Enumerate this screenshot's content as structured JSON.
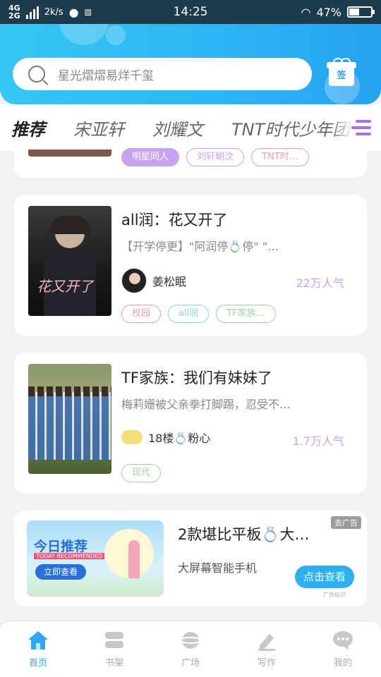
{
  "status_bar": {
    "network_top": "4G",
    "network_bottom": "2G",
    "speed": "2k/s",
    "time": "14:25",
    "battery": "47%",
    "battery_level": 0.47
  },
  "search": {
    "placeholder": "星光熠熠易烊千玺"
  },
  "gift": {
    "label": "签"
  },
  "tabs": [
    {
      "label": "推荐",
      "active": true
    },
    {
      "label": "宋亚轩"
    },
    {
      "label": "刘耀文"
    },
    {
      "label": "TNT时代少年团"
    }
  ],
  "cards": [
    {
      "tags": [
        {
          "label": "明星同人",
          "color": "#b98af2",
          "filled": true
        },
        {
          "label": "刘轩朝汶",
          "color": "#c8a6f4"
        },
        {
          "label": "TNT时…",
          "color": "#f0a0a8"
        }
      ]
    },
    {
      "title": "all润：花又开了",
      "desc": "【开学停更】\"阿润停💍停\"  \"…",
      "author": "姜松眠",
      "popularity": "22万人气",
      "cover_text": "花又开了",
      "tags": [
        {
          "label": "校园",
          "color": "#f0a0a0"
        },
        {
          "label": "all润",
          "color": "#8fd0ef"
        },
        {
          "label": "TF家族…",
          "color": "#9fd49f"
        }
      ]
    },
    {
      "title": "TF家族：我们有妹妹了",
      "desc": "梅莉姗被父亲拳打脚踢，忍受不…",
      "author": "18楼💍粉心",
      "popularity": "1.7万人气",
      "tags": [
        {
          "label": "现代",
          "color": "#9fd49f"
        }
      ]
    }
  ],
  "ad": {
    "title": "2款堪比平板💍大…",
    "desc": "大屏幕智能手机",
    "badge": "去广告",
    "button": "点击查看",
    "small": "广告标识",
    "img_title": "今日推荐",
    "img_sub": "TODAY RECOMMENDED",
    "img_btn": "立即查看"
  },
  "bottom_nav": [
    {
      "label": "首页",
      "icon": "home-icon",
      "active": true
    },
    {
      "label": "书架",
      "icon": "bookshelf-icon"
    },
    {
      "label": "广场",
      "icon": "planet-icon"
    },
    {
      "label": "写作",
      "icon": "pen-icon"
    },
    {
      "label": "我的",
      "icon": "chat-icon"
    }
  ]
}
